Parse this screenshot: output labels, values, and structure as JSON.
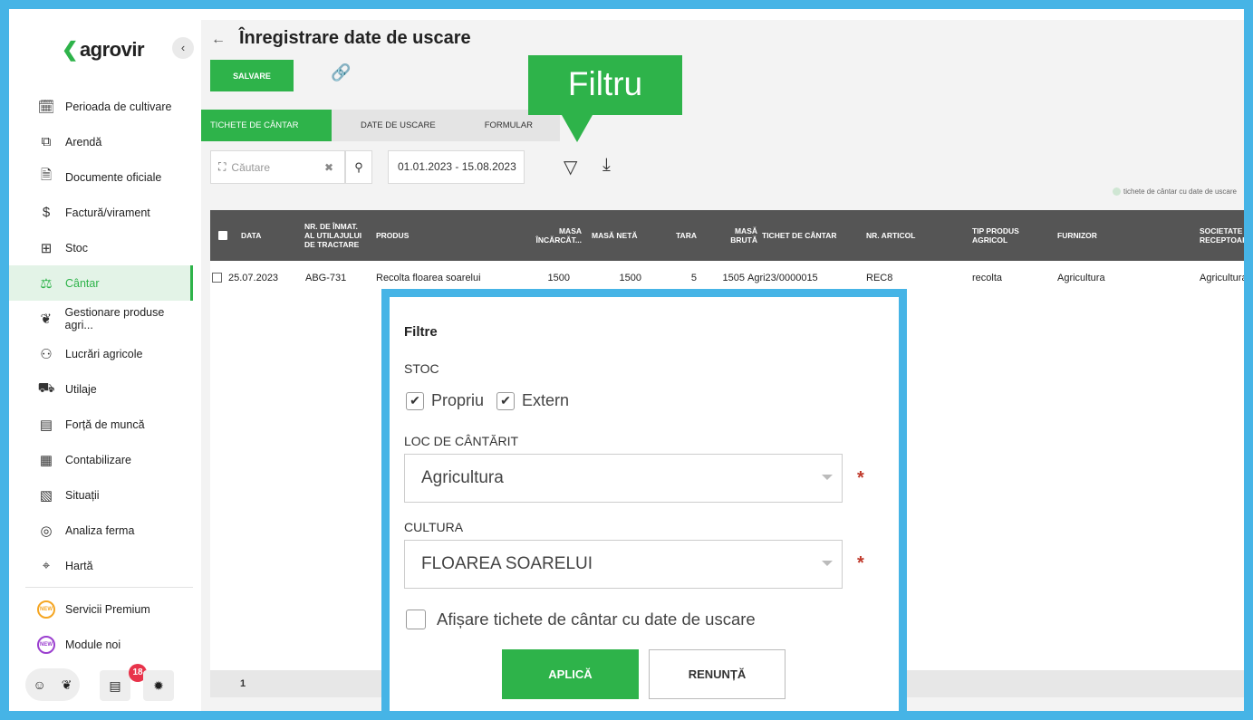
{
  "app": {
    "logo_text": "agrovir",
    "collapse_glyph": "‹"
  },
  "sidebar": {
    "items": [
      {
        "label": "Perioada de cultivare",
        "icon": "calendar-plant-icon",
        "glyph": "🗓"
      },
      {
        "label": "Arendă",
        "icon": "puzzle-icon",
        "glyph": "⧉"
      },
      {
        "label": "Documente oficiale",
        "icon": "document-icon",
        "glyph": "🗎"
      },
      {
        "label": "Factură/virament",
        "icon": "invoice-icon",
        "glyph": "$"
      },
      {
        "label": "Stoc",
        "icon": "stock-icon",
        "glyph": "⊞"
      },
      {
        "label": "Cântar",
        "icon": "scale-icon",
        "glyph": "⚖",
        "active": true
      },
      {
        "label": "Gestionare produse agri...",
        "icon": "plant-hand-icon",
        "glyph": "❦"
      },
      {
        "label": "Lucrări agricole",
        "icon": "workers-icon",
        "glyph": "⚇"
      },
      {
        "label": "Utilaje",
        "icon": "tractor-icon",
        "glyph": "⛟"
      },
      {
        "label": "Forță de muncă",
        "icon": "id-card-icon",
        "glyph": "▤"
      },
      {
        "label": "Contabilizare",
        "icon": "abacus-icon",
        "glyph": "▦"
      },
      {
        "label": "Situații",
        "icon": "report-icon",
        "glyph": "▧"
      },
      {
        "label": "Analiza ferma",
        "icon": "analysis-icon",
        "glyph": "◎"
      },
      {
        "label": "Hartă",
        "icon": "map-icon",
        "glyph": "⌖"
      }
    ],
    "extras": [
      {
        "label": "Servicii Premium",
        "badge": "NEW",
        "color": "#f5a623"
      },
      {
        "label": "Module noi",
        "badge": "NEW",
        "color": "#9b3fcf"
      }
    ],
    "notification_count": "18"
  },
  "header": {
    "back_glyph": "←",
    "title": "Înregistrare date de uscare",
    "save_label": "SALVARE"
  },
  "callout": {
    "text": "Filtru"
  },
  "tabs": [
    "TICHETE DE CÂNTAR",
    "DATE DE USCARE",
    "FORMULAR"
  ],
  "toolbar": {
    "search_placeholder": "Căutare",
    "clear_glyph": "✖",
    "date_range": "01.01.2023 - 15.08.2023",
    "legend_text": "tichete de cântar cu date de uscare"
  },
  "table": {
    "columns": [
      "DATA",
      "NR. DE ÎNMAT. AL UTILAJULUI DE TRACTARE",
      "PRODUS",
      "MASA ÎNCĂRCĂT...",
      "MASĂ NETĂ",
      "TARA",
      "MASĂ BRUTĂ",
      "TICHET DE CÂNTAR",
      "NR. ARTICOL",
      "TIP PRODUS AGRICOL",
      "FURNIZOR",
      "SOCIETATE RECEPTOAR"
    ],
    "rows": [
      {
        "data": "25.07.2023",
        "nr": "ABG-731",
        "produs": "Recolta floarea soarelui",
        "masa_incarcat": "1500",
        "masa_neta": "1500",
        "tara": "5",
        "masa_bruta": "1505",
        "tichet": "Agri23/0000015",
        "articol": "REC8",
        "tip": "recolta",
        "furnizor": "Agricultura",
        "societate": "Agricultura"
      }
    ],
    "page": "1"
  },
  "modal": {
    "title": "Filtre",
    "stoc_label": "STOC",
    "stoc_options": [
      "Propriu",
      "Extern"
    ],
    "loc_label": "LOC DE CÂNTĂRIT",
    "loc_value": "Agricultura",
    "cultura_label": "CULTURA",
    "cultura_value": "FLOAREA SOARELUI",
    "required_mark": "*",
    "show_tickets_label": "Afișare tichete de cântar cu date de uscare",
    "apply_label": "APLICĂ",
    "cancel_label": "RENUNȚĂ"
  }
}
